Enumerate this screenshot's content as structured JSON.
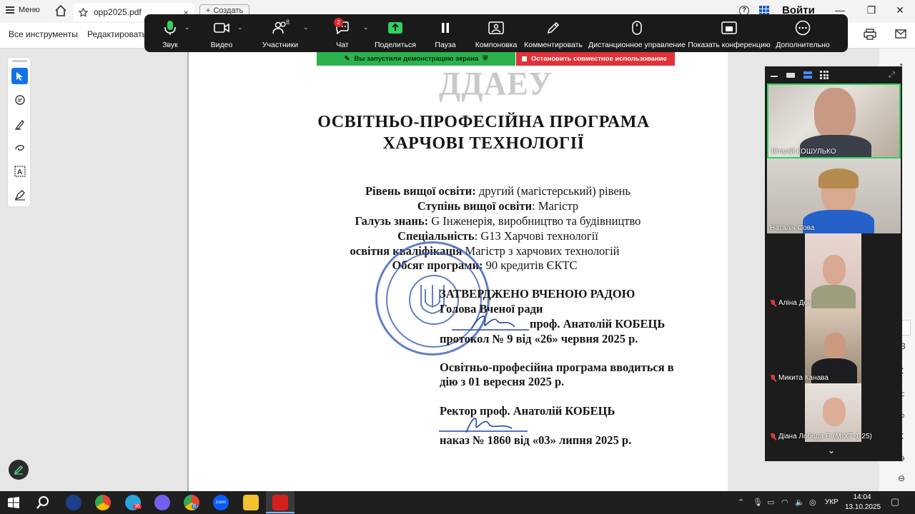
{
  "acrobat": {
    "menu_label": "Меню",
    "tab_title": "opp2025.pdf",
    "tab_close": "×",
    "create_label": "Создать",
    "signin_label": "Войти",
    "all_tools_label": "Все инструменты",
    "edit_label": "Редактировать"
  },
  "zoom": {
    "toolbar": [
      {
        "label": "Звук"
      },
      {
        "label": "Видео"
      },
      {
        "label": "Участники",
        "count": "8"
      },
      {
        "label": "Чат",
        "badge": "2"
      },
      {
        "label": "Поделиться"
      },
      {
        "label": "Пауза"
      },
      {
        "label": "Компоновка"
      },
      {
        "label": "Комментировать"
      },
      {
        "label": "Дистанционное управление"
      },
      {
        "label": "Показать конференцию"
      },
      {
        "label": "Дополнительно"
      }
    ],
    "share_status": "Вы запустили демонстрацию экрана",
    "stop_share": "Остановить совместное использование",
    "participants": [
      {
        "name": "Віталій КОШУЛЬКО",
        "muted": false,
        "active": true
      },
      {
        "name": "Наталія Сова",
        "muted": false,
        "active": false
      },
      {
        "name": "Аліна Дон",
        "muted": true,
        "active": false
      },
      {
        "name": "Микита Канава",
        "muted": true,
        "active": false
      },
      {
        "name": "Діана Лобода Р. (МгХТ-1-25)",
        "muted": true,
        "active": false
      }
    ]
  },
  "document": {
    "logo": "ДДАЕУ",
    "title_line1": "ОСВІТНЬО-ПРОФЕСІЙНА ПРОГРАМА",
    "title_line2": "ХАРЧОВІ ТЕХНОЛОГІЇ",
    "level_label": "Рівень вищої освіти:",
    "level_value": " другий (магістерський) рівень",
    "degree_label": "Ступінь вищої освіти",
    "degree_value": ": Магістр",
    "field_label": "Галузь знань:",
    "field_value": " G Інженерія, виробництво та будівництво",
    "specialty_label": "Спеціальність",
    "specialty_value": ": G13 Харчові технології",
    "qualification_label": "освітня кваліфікація",
    "qualification_value": " Магістр з харчових технологій",
    "volume_label": "Обсяг програми:",
    "volume_value": " 90 кредитів ЄКТС",
    "approved": "ЗАТВЕРДЖЕНО ВЧЕНОЮ РАДОЮ",
    "chair": "Голова Вченої ради",
    "chair_name": "проф. Анатолій КОБЕЦЬ",
    "protocol": "протокол № 9 від «26» червня 2025 р.",
    "intro_line1": "Освітньо-професійна програма вводиться в",
    "intro_line2": "дію з 01  вересня 2025 р.",
    "rector": "Ректор проф. Анатолій КОБЕЦЬ",
    "order": "наказ № 1860 від «03» липня 2025 р."
  },
  "right_strip": {
    "glyph_3": "3"
  },
  "taskbar": {
    "telegram_badge": "36",
    "chrome_badge": "8",
    "zoom_icon_label": "zoom",
    "lang": "УКР",
    "time": "14:04",
    "date": "13.10.2025"
  }
}
